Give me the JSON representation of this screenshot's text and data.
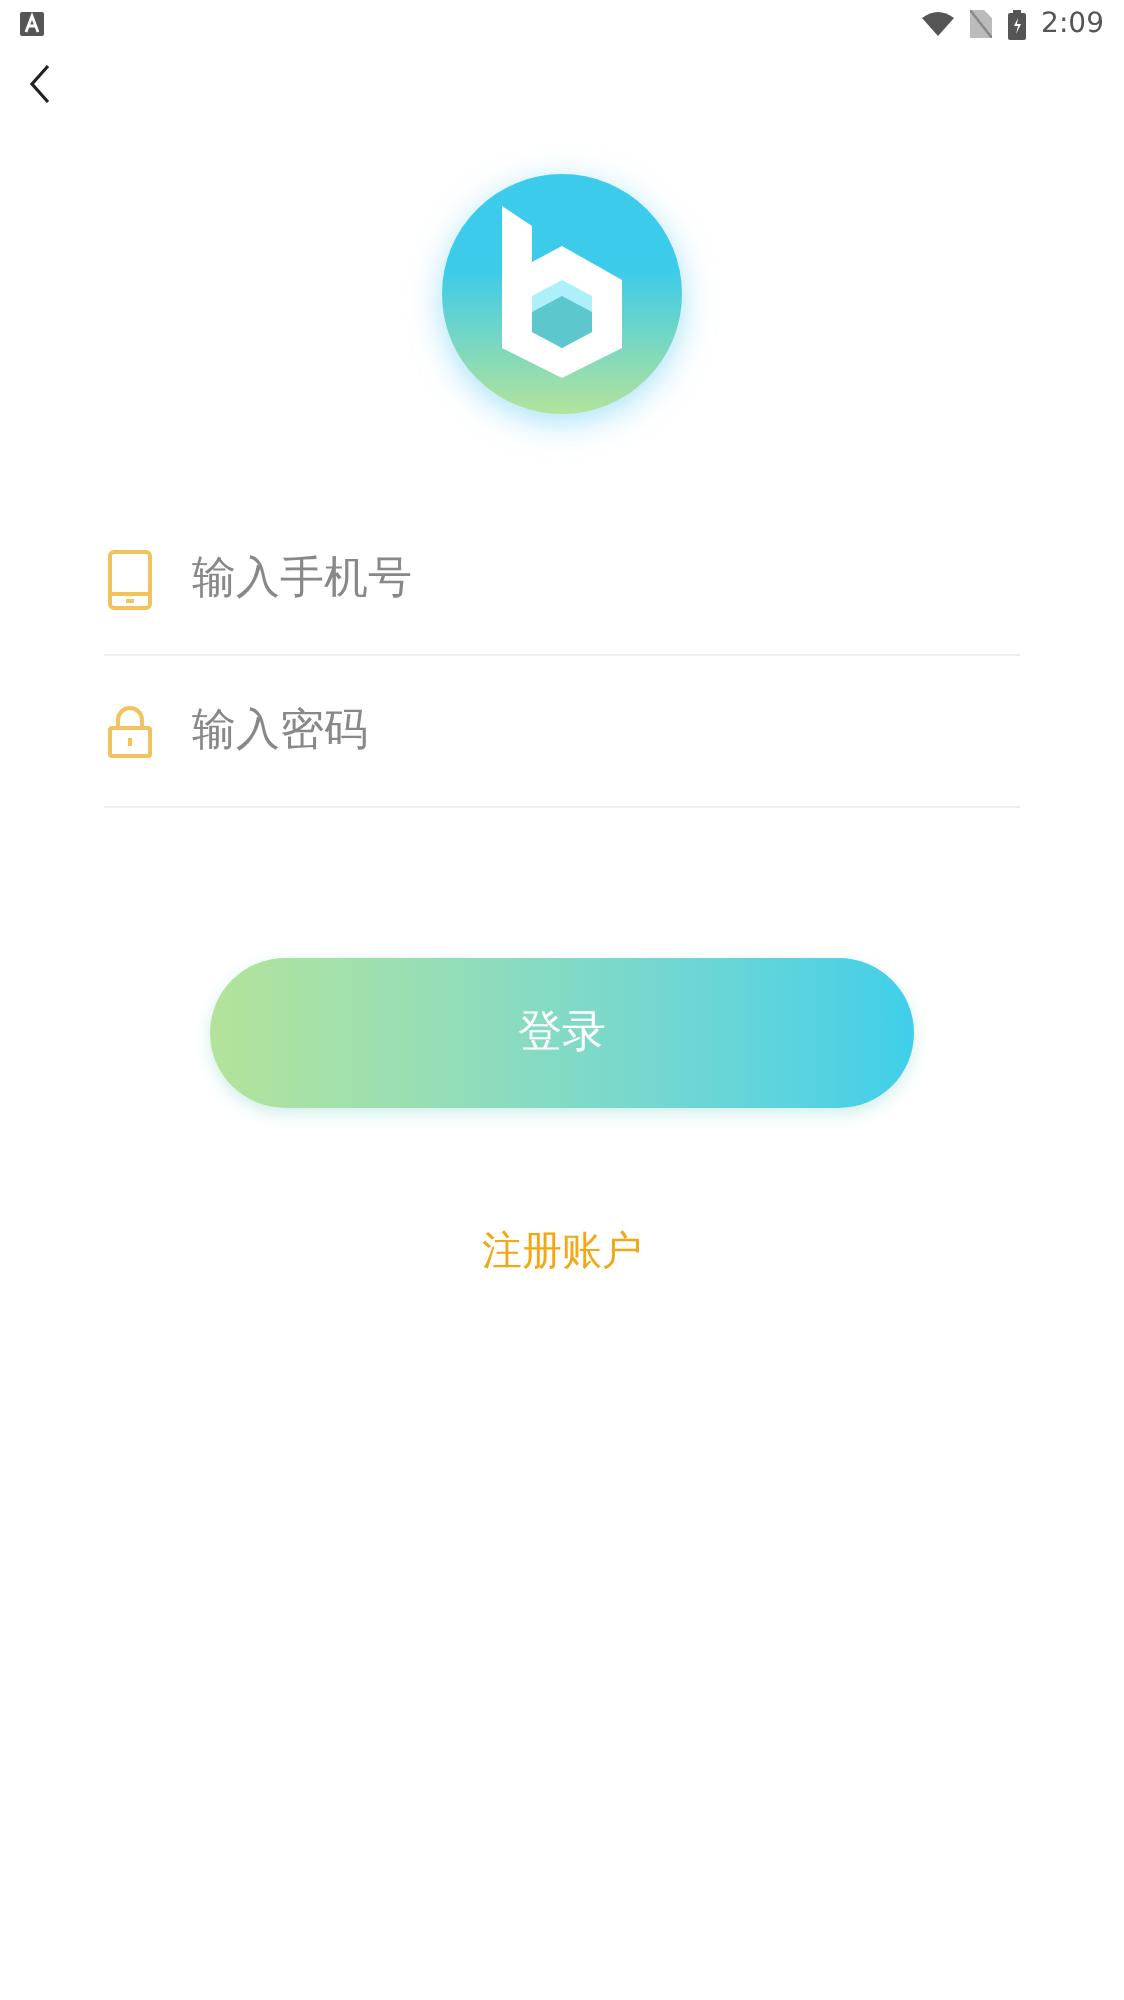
{
  "status_bar": {
    "time": "2:09"
  },
  "fields": [
    {
      "kind": "phone",
      "placeholder": "输入手机号"
    },
    {
      "kind": "password",
      "placeholder": "输入密码"
    }
  ],
  "login_button": "登录",
  "register_link": "注册账户"
}
